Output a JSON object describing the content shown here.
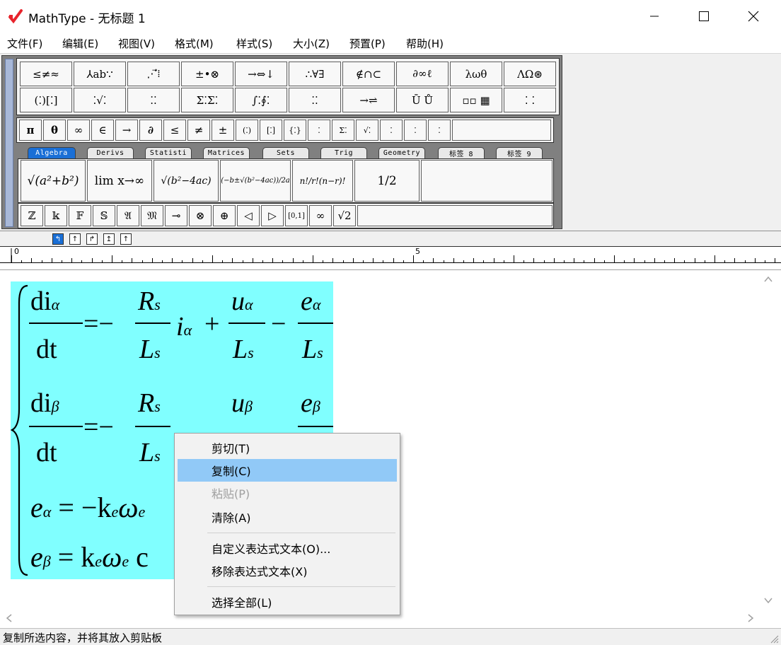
{
  "window": {
    "title": "MathType - 无标题 1"
  },
  "menu": [
    "文件(F)",
    "编辑(E)",
    "视图(V)",
    "格式(M)",
    "样式(S)",
    "大小(Z)",
    "预置(P)",
    "帮助(H)"
  ],
  "toolbar": {
    "palette_row1": [
      "≤≠≈",
      "⅄ab∵",
      "⋰⃗⁞",
      "±•⊗",
      "→⇔↓",
      "∴∀∃",
      "∉∩⊂",
      "∂∞ℓ",
      "λωθ",
      "ΛΩ⊛"
    ],
    "palette_row2": [
      "(⁚)[⁚]",
      "⁚√⁚",
      "⁚⁚",
      "Σ⁚Σ⁚",
      "∫⁚∮⁚",
      "⁚⁚",
      "→⇌",
      "Ū Ů",
      "▫▫ ▦",
      "⁚ ⁚"
    ],
    "symbol_row": [
      "π",
      "θ",
      "∞",
      "∈",
      "→",
      "∂",
      "≤",
      "≠",
      "±",
      "(⁚)",
      "[⁚]",
      "{⁚}",
      "⁚",
      "Σ⁚",
      "√⁚",
      "⁚",
      "⁚",
      "⁚"
    ],
    "tabs": [
      "Algebra",
      "Derivs",
      "Statisti",
      "Matrices",
      "Sets",
      "Trig",
      "Geometry",
      "标签 8",
      "标签 9"
    ],
    "templates": [
      "√(a²+b²)",
      "lim x→∞",
      "√(b²−4ac)",
      "(−b±√(b²−4ac))/2a",
      "n!/r!(n−r)!",
      "1/2"
    ],
    "bottom_row": [
      "ℤ",
      "𝕜",
      "𝔽",
      "𝕊",
      "𝔄",
      "𝔐",
      "⊸",
      "⊗",
      "⊕",
      "◁",
      "▷",
      "[0,1]",
      "∞",
      "√2"
    ]
  },
  "ruler": {
    "marks": [
      "0",
      "5"
    ]
  },
  "formula": {
    "line1": {
      "lhs_num": "di",
      "lhs_sub": "α",
      "lhs_den": "dt",
      "f1_num": "R",
      "f1_num_sub": "s",
      "f1_den": "L",
      "f1_den_sub": "s",
      "i": "i",
      "i_sub": "α",
      "f2_num": "u",
      "f2_num_sub": "α",
      "f2_den": "L",
      "f2_den_sub": "s",
      "f3_num": "e",
      "f3_num_sub": "α",
      "f3_den": "L",
      "f3_den_sub": "s"
    },
    "line2": {
      "lhs_num": "di",
      "lhs_sub": "β",
      "lhs_den": "dt",
      "f1_num": "R",
      "f1_num_sub": "s",
      "f1_den": "L",
      "f1_den_sub": "s",
      "f2_num": "u",
      "f2_num_sub": "β",
      "f3_num": "e",
      "f3_num_sub": "β"
    },
    "line3": {
      "text": "e",
      "sub": "α",
      "rest": "= −k",
      "rest_sub": "e",
      "omega": "ω",
      "omega_sub": "e"
    },
    "line4": {
      "text": "e",
      "sub": "β",
      "rest": "= k",
      "rest_sub": "e",
      "omega": "ω",
      "omega_sub": "e",
      "tail": "c"
    }
  },
  "context_menu": {
    "items": [
      {
        "label": "剪切(T)",
        "state": "normal"
      },
      {
        "label": "复制(C)",
        "state": "highlighted"
      },
      {
        "label": "粘贴(P)",
        "state": "disabled"
      },
      {
        "label": "清除(A)",
        "state": "normal"
      },
      {
        "label": "自定义表达式文本(O)...",
        "state": "normal"
      },
      {
        "label": "移除表达式文本(X)",
        "state": "normal"
      },
      {
        "label": "选择全部(L)",
        "state": "normal"
      }
    ]
  },
  "status": "复制所选内容，并将其放入剪贴板",
  "colors": {
    "selection": "#80ffff",
    "menu_highlight": "#91c9f7",
    "tab_active": "#1a6fd6",
    "logo": "#e8242c"
  }
}
